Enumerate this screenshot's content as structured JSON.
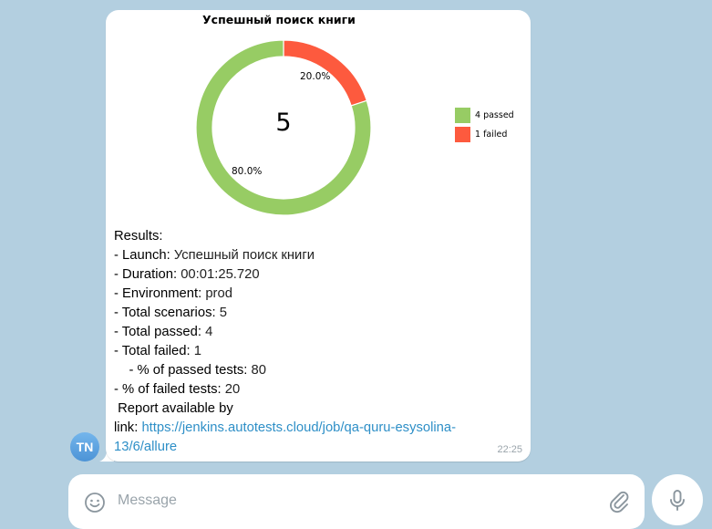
{
  "message": {
    "time": "22:25",
    "avatar_initials": "TN",
    "chart_data": {
      "type": "pie",
      "title": "Успешный поиск книги",
      "center_label": "5",
      "categories": [
        "4 passed",
        "1 failed"
      ],
      "values": [
        4,
        1
      ],
      "percent_labels": [
        "80.0%",
        "20.0%"
      ],
      "colors": [
        "#97cc64",
        "#fd5a3e"
      ],
      "legend_position": "right"
    },
    "results": {
      "heading": "Results:",
      "launch_label": " - Launch:",
      "launch_value": " Успешный поиск книги",
      "duration_label": " - Duration:",
      "duration_value": " 00:01:25.720",
      "environment_label": " - Environment:",
      "environment_value": " prod",
      "total_scenarios_label": " - Total scenarios:",
      "total_scenarios_value": " 5",
      "total_passed_label": " - Total passed:",
      "total_passed_value": " 4",
      "total_failed_label": " - Total failed:",
      "total_failed_value": " 1",
      "pct_passed_label": "    - % of passed tests:",
      "pct_passed_value": " 80",
      "pct_failed_label": " - % of failed tests:",
      "pct_failed_value": " 20",
      "report_line": " Report available by",
      "link_prefix": "link: ",
      "link_part1": "https://jenkins.autotests.cloud/job/qa-quru-esysolina-",
      "link_part2": "13/6/allure"
    }
  },
  "composer": {
    "placeholder": "Message"
  },
  "colors": {
    "background": "#b3cfe0",
    "link": "#2e8fc7",
    "passed": "#97cc64",
    "failed": "#fd5a3e"
  },
  "icons": {
    "emoji": "smile-icon",
    "attach": "paperclip-icon",
    "mic": "microphone-icon"
  }
}
